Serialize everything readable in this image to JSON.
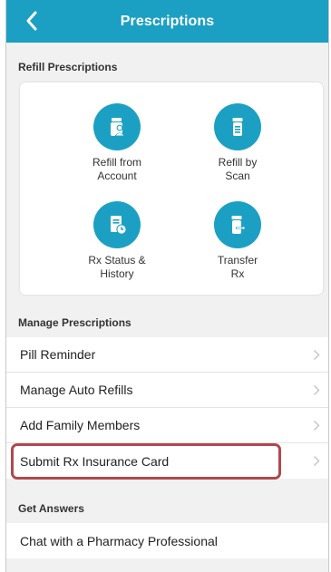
{
  "header": {
    "title": "Prescriptions"
  },
  "refill": {
    "section_label": "Refill Prescriptions",
    "tiles": [
      {
        "label": "Refill from\nAccount",
        "icon": "pill-bottle-person-icon"
      },
      {
        "label": "Refill by\nScan",
        "icon": "pill-bottle-scan-icon"
      },
      {
        "label": "Rx Status &\nHistory",
        "icon": "document-clock-icon"
      },
      {
        "label": "Transfer\nRx",
        "icon": "bottle-transfer-icon"
      }
    ]
  },
  "manage": {
    "section_label": "Manage Prescriptions",
    "items": [
      {
        "label": "Pill Reminder"
      },
      {
        "label": "Manage Auto Refills"
      },
      {
        "label": "Add Family Members"
      },
      {
        "label": "Submit Rx Insurance Card"
      }
    ]
  },
  "answers": {
    "section_label": "Get Answers",
    "items": [
      {
        "label": "Chat with a Pharmacy Professional"
      }
    ]
  },
  "colors": {
    "accent": "#1ba0c4",
    "highlight": "#b2484c"
  }
}
